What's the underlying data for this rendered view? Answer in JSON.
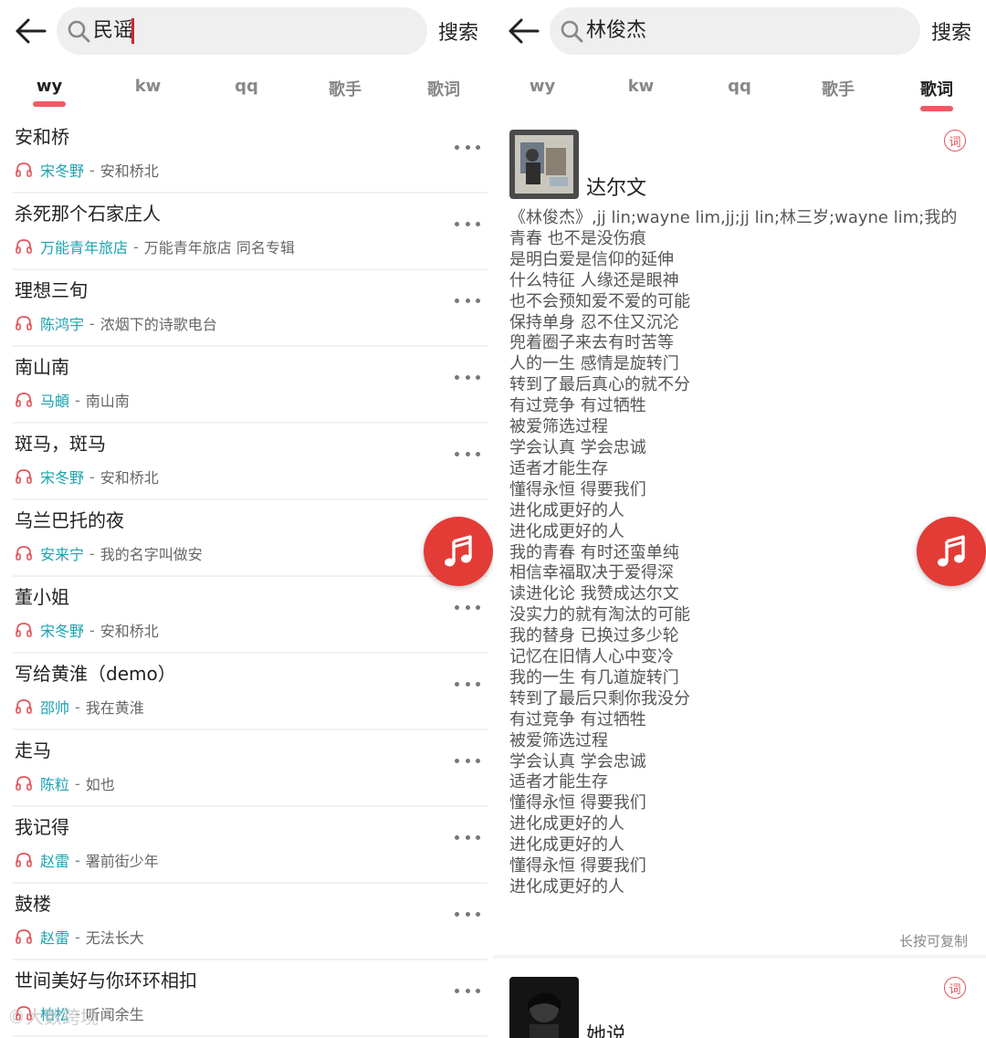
{
  "left_screen": {
    "search": {
      "value": "民谣",
      "button_label": "搜索"
    },
    "tabs": [
      {
        "label": "wy",
        "active": true
      },
      {
        "label": "kw",
        "active": false
      },
      {
        "label": "qq",
        "active": false
      },
      {
        "label": "歌手",
        "active": false
      },
      {
        "label": "歌词",
        "active": false
      }
    ],
    "songs": [
      {
        "title": "安和桥",
        "artist": "宋冬野",
        "separator": "-",
        "album": "安和桥北"
      },
      {
        "title": "杀死那个石家庄人",
        "artist": "万能青年旅店",
        "separator": "-",
        "album": "万能青年旅店 同名专辑"
      },
      {
        "title": "理想三旬",
        "artist": "陈鸿宇",
        "separator": "-",
        "album": "浓烟下的诗歌电台"
      },
      {
        "title": "南山南",
        "artist": "马頔",
        "separator": "-",
        "album": "南山南"
      },
      {
        "title": "斑马，斑马",
        "artist": "宋冬野",
        "separator": "-",
        "album": "安和桥北"
      },
      {
        "title": "乌兰巴托的夜",
        "artist": "安来宁",
        "separator": "-",
        "album": "我的名字叫做安"
      },
      {
        "title": "董小姐",
        "artist": "宋冬野",
        "separator": "-",
        "album": "安和桥北"
      },
      {
        "title": "写给黄淮（demo）",
        "artist": "邵帅",
        "separator": "-",
        "album": "我在黄淮"
      },
      {
        "title": "走马",
        "artist": "陈粒",
        "separator": "-",
        "album": "如也"
      },
      {
        "title": "我记得",
        "artist": "赵雷",
        "separator": "-",
        "album": "署前街少年"
      },
      {
        "title": "鼓楼",
        "artist": "赵雷",
        "separator": "-",
        "album": "无法长大"
      },
      {
        "title": "世间美好与你环环相扣",
        "artist": "柏松",
        "separator": "-",
        "album": "听闻余生"
      }
    ],
    "watermark": "©大数跨境"
  },
  "right_screen": {
    "search": {
      "value": "林俊杰",
      "button_label": "搜索"
    },
    "tabs": [
      {
        "label": "wy",
        "active": false
      },
      {
        "label": "kw",
        "active": false
      },
      {
        "label": "qq",
        "active": false
      },
      {
        "label": "歌手",
        "active": false
      },
      {
        "label": "歌词",
        "active": true
      }
    ],
    "cards": [
      {
        "title": "达尔文",
        "badge": "词",
        "lyrics": [
          "《林俊杰》,jj lin;wayne lim,jj;jj lin;林三岁;wayne lim;我的",
          "青春 也不是没伤痕",
          "是明白爱是信仰的延伸",
          "什么特征 人缘还是眼神",
          "也不会预知爱不爱的可能",
          "保持单身 忍不住又沉沦",
          "兜着圈子来去有时苦等",
          "人的一生 感情是旋转门",
          "转到了最后真心的就不分",
          "有过竞争 有过牺牲",
          "被爱筛选过程",
          "学会认真 学会忠诚",
          "适者才能生存",
          "懂得永恒 得要我们",
          "进化成更好的人",
          "进化成更好的人",
          "我的青春 有时还蛮单纯",
          "相信幸福取决于爱得深",
          "读进化论 我赞成达尔文",
          "没实力的就有淘汰的可能",
          "我的替身 已换过多少轮",
          "记忆在旧情人心中变冷",
          "我的一生 有几道旋转门",
          "转到了最后只剩你我没分",
          "有过竞争 有过牺牲",
          "被爱筛选过程",
          "学会认真 学会忠诚",
          "适者才能生存",
          "懂得永恒 得要我们",
          "进化成更好的人",
          "进化成更好的人",
          "懂得永恒 得要我们",
          "进化成更好的人"
        ],
        "copy_hint": "长按可复制"
      },
      {
        "title": "她说",
        "badge": "词"
      }
    ]
  },
  "colors": {
    "accent": "#e33c36",
    "tab_underline": "#f05a63",
    "artist_link": "#1aa3b2",
    "caret": "#d8232a"
  },
  "icons": [
    "back-arrow-icon",
    "search-icon",
    "headphone-icon",
    "more-dots-icon",
    "music-note-icon",
    "lyrics-badge-icon"
  ]
}
